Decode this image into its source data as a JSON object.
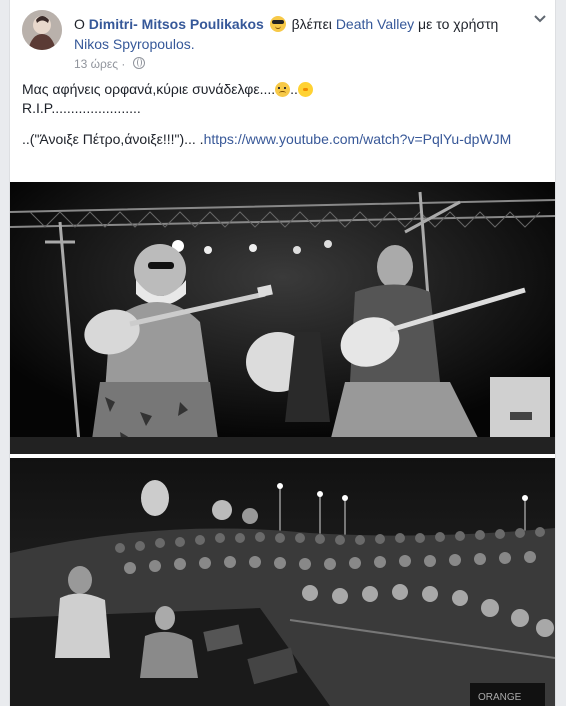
{
  "post": {
    "prefix": "Ο",
    "author": "Dimitri- Mitsos Poulikakos",
    "activity": "βλέπει",
    "title": "Death Valley",
    "connector": "με το",
    "with_prefix": "χρήστη",
    "with_user": "Nikos Spyropoulos.",
    "timestamp": "13 ώρες",
    "separator": "·",
    "menu_icon": "chevron-down-icon",
    "privacy_icon": "globe-icon",
    "feeling_icon": "cool-face-icon"
  },
  "body": {
    "line1": "Μας αφήνεις ορφανά,κύριε συνάδελφε....",
    "line1_sep": "..",
    "line2": "R.I.P.......................",
    "line3_text": "..(\"Άνοιξε Πέτρο,άνοιξε!!!\")... .",
    "link": "https://www.youtube.com/watch?v=PqlYu-dpWJM"
  },
  "media": {
    "photo1": "stage-duo-photo",
    "photo2": "crowd-photo",
    "photo2_sign": "ORANGE"
  }
}
